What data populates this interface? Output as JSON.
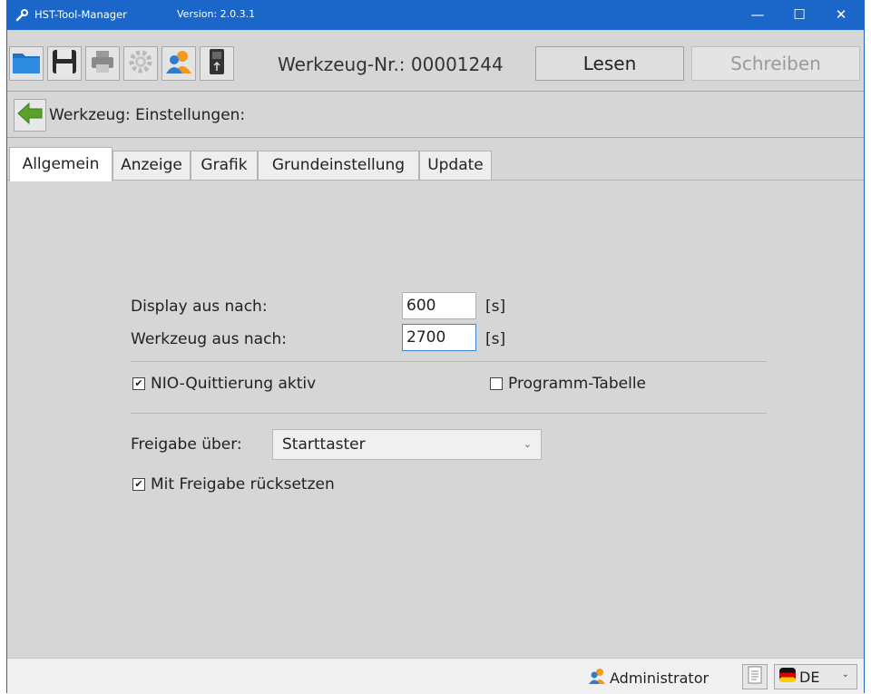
{
  "window": {
    "title": "HST-Tool-Manager",
    "version": "Version: 2.0.3.1",
    "controls": {
      "minimize": "—",
      "maximize": "☐",
      "close": "✕"
    }
  },
  "toolbar": {
    "icons": [
      "open-folder-icon",
      "save-icon",
      "print-icon",
      "settings-icon",
      "users-icon",
      "usb-device-icon"
    ],
    "tool_number": "Werkzeug-Nr.: 00001244",
    "read_label": "Lesen",
    "write_label": "Schreiben"
  },
  "section": {
    "title": "Werkzeug: Einstellungen:"
  },
  "tabs": [
    {
      "label": "Allgemein",
      "active": true
    },
    {
      "label": "Anzeige",
      "active": false
    },
    {
      "label": "Grafik",
      "active": false
    },
    {
      "label": "Grundeinstellung",
      "active": false
    },
    {
      "label": "Update",
      "active": false
    }
  ],
  "form": {
    "display_off_label": "Display aus nach:",
    "display_off_value": "600",
    "display_off_unit": "[s]",
    "tool_off_label": "Werkzeug aus nach:",
    "tool_off_value": "2700",
    "tool_off_unit": "[s]",
    "nio_ack_label": "NIO-Quittierung aktiv",
    "nio_ack_checked": true,
    "program_table_label": "Programm-Tabelle",
    "program_table_checked": false,
    "release_label": "Freigabe über:",
    "release_value": "Starttaster",
    "reset_with_release_label": "Mit Freigabe rücksetzen",
    "reset_with_release_checked": true
  },
  "status": {
    "user": "Administrator",
    "language": "DE"
  },
  "colors": {
    "titlebar": "#1b67c9",
    "background": "#d6d6d6",
    "accent_arrow": "#5aa02c"
  }
}
